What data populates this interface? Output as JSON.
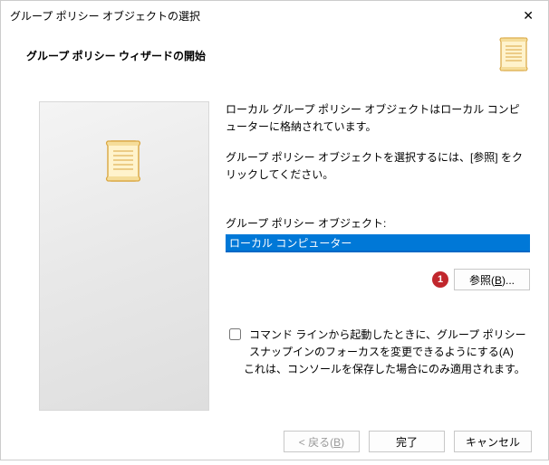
{
  "titlebar": {
    "title": "グループ ポリシー オブジェクトの選択"
  },
  "header": {
    "title": "グループ ポリシー ウィザードの開始"
  },
  "content": {
    "desc1": "ローカル グループ ポリシー オブジェクトはローカル コンピューターに格納されています。",
    "desc2": "グループ ポリシー オブジェクトを選択するには、[参照] をクリックしてください。",
    "field_label": "グループ ポリシー オブジェクト:",
    "field_value": "ローカル コンピューター",
    "browse_label": "参照(B)...",
    "marker": "1",
    "checkbox_label": "コマンド ラインから起動したときに、グループ ポリシー スナップインのフォーカスを変更できるようにする(A)",
    "checkbox_note": "これは、コンソールを保存した場合にのみ適用されます。"
  },
  "footer": {
    "back_prefix": "< 戻る(",
    "back_u": "B",
    "back_suffix": ")",
    "finish": "完了",
    "cancel": "キャンセル"
  }
}
